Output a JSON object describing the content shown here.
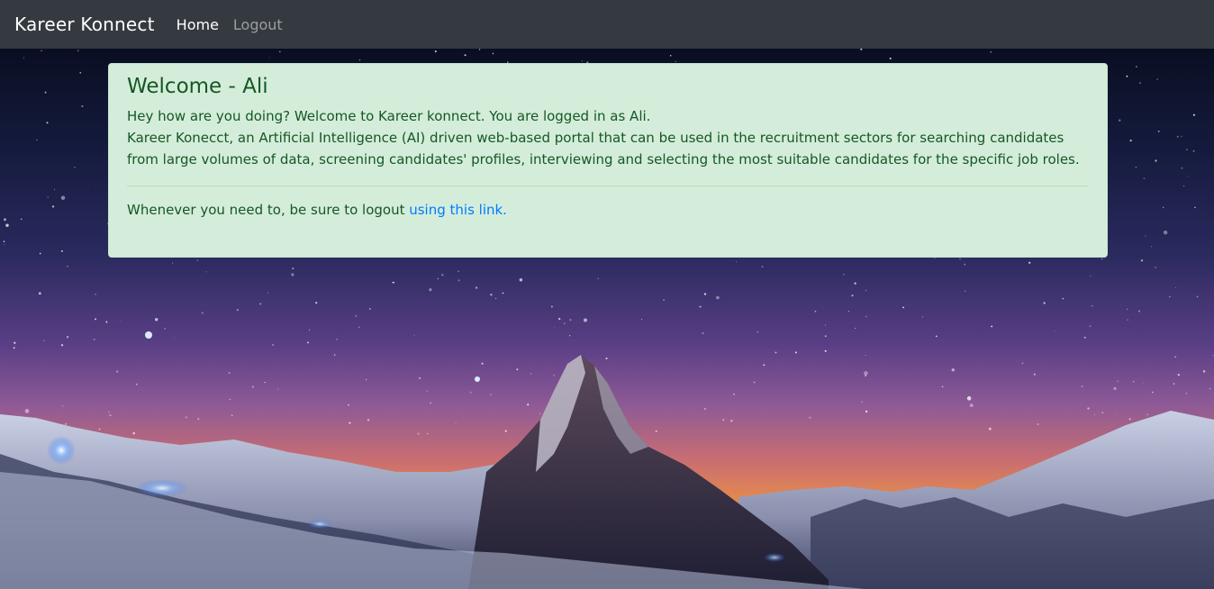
{
  "navbar": {
    "brand": "Kareer Konnect",
    "links": [
      {
        "label": "Home",
        "active": true
      },
      {
        "label": "Logout",
        "active": false
      }
    ]
  },
  "alert": {
    "heading": "Welcome - Ali",
    "line1": "Hey how are you doing? Welcome to Kareer konnect. You are logged in as Ali.",
    "line2": "Kareer Konecct, an Artificial Intelligence (AI) driven web-based portal that can be used in the recruitment sectors for searching candidates from large volumes of data, screening candidates' profiles, interviewing and selecting the most suitable candidates for the specific job roles.",
    "footer_text": "Whenever you need to, be sure to logout ",
    "footer_link": "using this link."
  },
  "colors": {
    "navbar_bg": "#343a40",
    "alert_bg": "#d4edda",
    "alert_text": "#155724",
    "link": "#007bff"
  }
}
